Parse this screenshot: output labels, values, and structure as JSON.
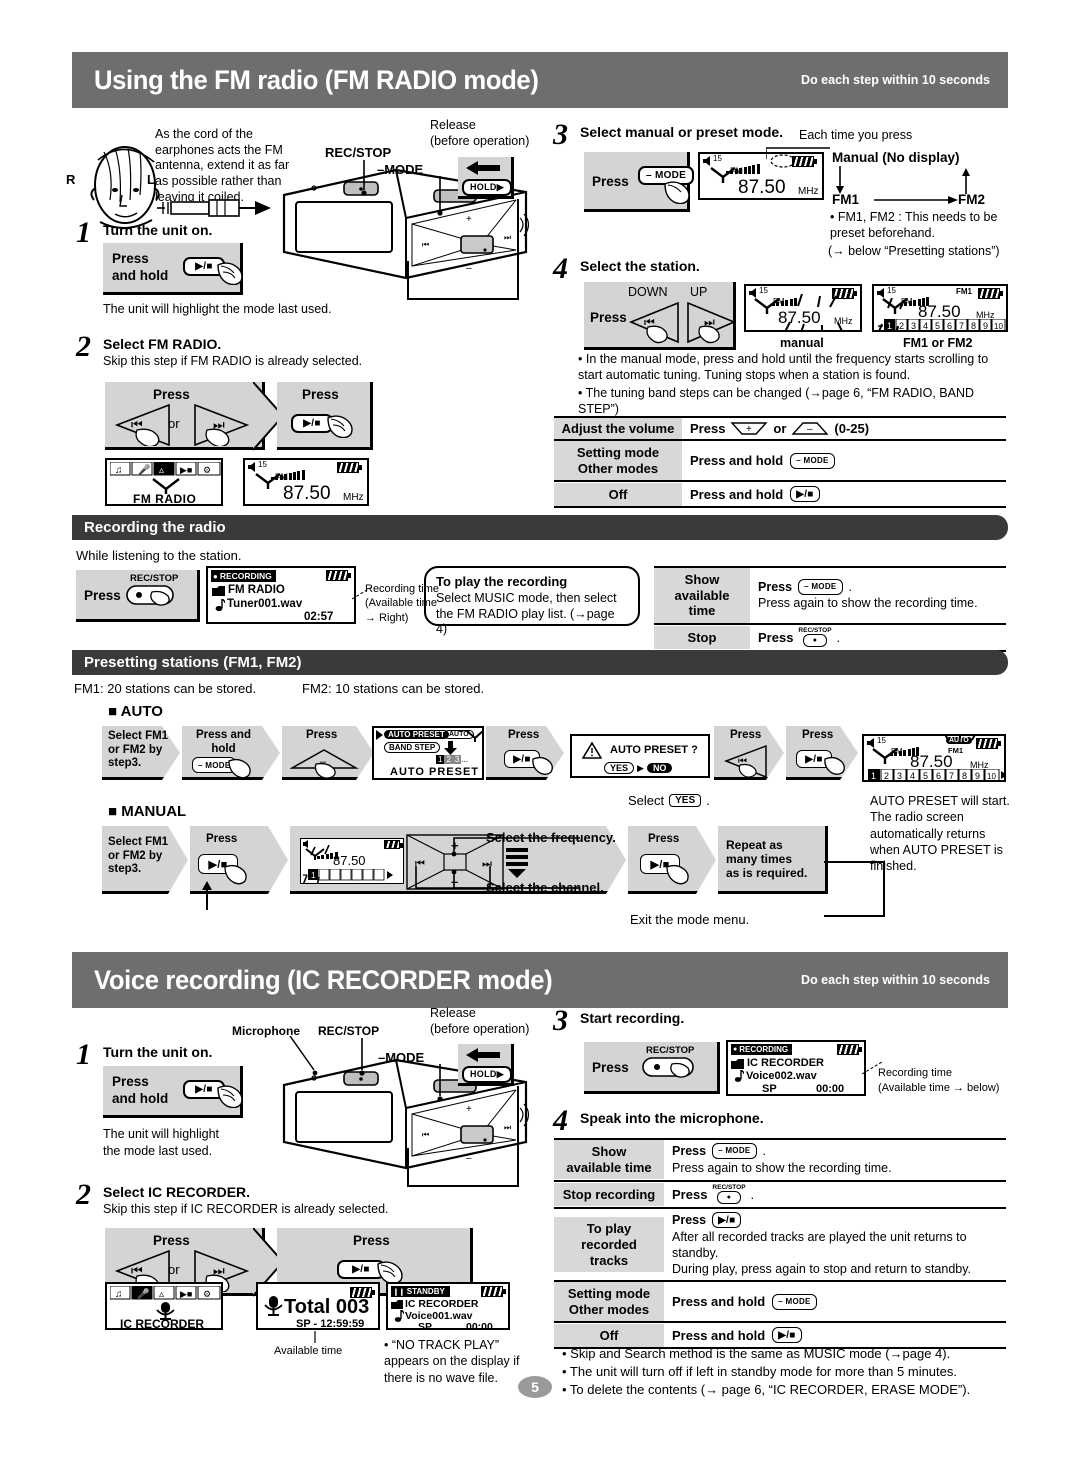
{
  "page_number": "5",
  "fm_section": {
    "title": "Using the FM radio (FM RADIO mode)",
    "note": "Do each step within 10 seconds",
    "antenna_note": "As the cord of the earphones acts the FM antenna, extend it as far as possible rather than leaving it coiled.",
    "ear_r": "R",
    "ear_l": "L",
    "label_rec_stop": "REC/STOP",
    "label_mode": "–MODE",
    "label_release": "Release\n(before operation)",
    "label_hold": "HOLD▶",
    "step1": {
      "num": "1",
      "title": "Turn the unit on.",
      "press_label": "Press\nand hold",
      "key": "▶/■",
      "after": "The unit will highlight the mode last used."
    },
    "step2": {
      "num": "2",
      "title": "Select FM RADIO.",
      "sub": "Skip this step if FM RADIO is already selected.",
      "press1": "Press",
      "or": "or",
      "press2": "Press",
      "key_prev": "⏮",
      "key_next": "⏭",
      "key_play": "▶/■",
      "menu_label": "FM RADIO",
      "lcd_vol": "15",
      "lcd_band": "FM",
      "lcd_freq": "87.50",
      "lcd_unit": "MHz"
    },
    "step3": {
      "num": "3",
      "title": "Select manual or preset mode.",
      "press": "Press",
      "key_mode": "– MODE",
      "lcd_vol": "15",
      "lcd_band": "FM",
      "lcd_freq": "87.50",
      "lcd_unit": "MHz",
      "each_time": "Each time you press",
      "cycle_manual": "Manual (No display)",
      "cycle_fm1": "FM1",
      "cycle_fm2": "FM2",
      "bullet": "• FM1, FM2 : This needs to be preset beforehand.",
      "bullet2": "(→ below “Presetting stations”)"
    },
    "step4": {
      "num": "4",
      "title": "Select the station.",
      "press": "Press",
      "down": "DOWN",
      "up": "UP",
      "key_prev": "⏮",
      "key_next": "⏭",
      "lcd1_caption": "manual",
      "lcd2_caption": "FM1 or FM2",
      "lcd_vol": "15",
      "lcd_band": "FM",
      "lcd_freq": "87.50",
      "lcd_unit": "MHz",
      "lcd2_fm1": "FM1",
      "presets": [
        "1",
        "2",
        "3",
        "4",
        "5",
        "6",
        "7",
        "8",
        "9",
        "10"
      ],
      "bullet1": "• In the manual mode, press and hold until the frequency starts scrolling to start automatic tuning. Tuning stops when a station is found.",
      "bullet2": "• The tuning band steps can be changed (→page 6, “FM RADIO, BAND STEP”)"
    },
    "ops_table": [
      {
        "key": "Adjust the volume",
        "value_pre": "Press",
        "value_post": "(0-25)",
        "kind": "volume"
      },
      {
        "key": "Setting mode\nOther modes",
        "value_pre": "Press and hold",
        "key_glyph": "– MODE",
        "kind": "mode"
      },
      {
        "key": "Off",
        "value_pre": "Press and hold",
        "key_glyph": "▶/■",
        "kind": "play"
      }
    ]
  },
  "recording_section": {
    "title": "Recording the radio",
    "intro": "While listening to the station.",
    "press": "Press",
    "key_rec": "REC/STOP",
    "lcd_status": "RECORDING",
    "lcd_line1": "FM  RADIO",
    "lcd_line2": "Tuner001.wav",
    "lcd_time": "02:57",
    "callout": "Recording time\n(Available time\n→ Right)",
    "note_title": "To play the recording",
    "note_body": "Select MUSIC mode, then select the FM RADIO play list. (→page 4)",
    "ops_table": [
      {
        "key": "Show available\ntime",
        "value_pre": "Press",
        "key_glyph": "– MODE",
        "value_post": ".",
        "extra": "Press again to show the recording time."
      },
      {
        "key": "Stop",
        "value_pre": "Press",
        "key_glyph": "REC/STOP",
        "value_post": "."
      }
    ]
  },
  "preset_section": {
    "title": "Presetting stations (FM1, FM2)",
    "fm1_note": "FM1: 20 stations can be stored.",
    "fm2_note": "FM2: 10 stations can be stored.",
    "auto_heading": "AUTO",
    "manual_heading": "MANUAL",
    "auto_steps": {
      "s1": "Select FM1\nor FM2 by\nstep3.",
      "s2": "Press and\nhold",
      "s2_key": "– MODE",
      "s3": "Press",
      "s4_lcd_line1": "AUTO PRESET",
      "s4_lcd_auto": "AUTO",
      "s4_lcd_line2": "BAND STEP",
      "s4_lcd_nums": "1 2 3 ...",
      "s4_lcd_caption": "AUTO PRESET",
      "s5": "Press",
      "s5_key": "▶/■",
      "s6_lcd_warn": "AUTO PRESET ?",
      "s6_yes": "YES",
      "s6_no": "NO",
      "s7": "Press",
      "s7_key": "⏮",
      "s7_caption": "Select",
      "s7_caption_key": "YES",
      "s7_caption_end": ".",
      "s8": "Press",
      "s8_key": "▶/■",
      "s9_lcd_vol": "15",
      "s9_lcd_auto": "AUTO",
      "s9_lcd_fm1": "FM1",
      "s9_lcd_band": "FM",
      "s9_lcd_freq": "87.50",
      "s9_lcd_unit": "MHz",
      "s9_presets": [
        "1",
        "2",
        "3",
        "4",
        "5",
        "6",
        "7",
        "8",
        "9",
        "10"
      ],
      "after_note": "AUTO PRESET will start. The radio screen automatically returns when AUTO PRESET is finished."
    },
    "manual_steps": {
      "m1": "Select FM1\nor FM2 by\nstep3.",
      "m2": "Press",
      "m2_key": "▶/■",
      "m3_freq_label": "Select the frequency.",
      "m3_chan_label": "Select the channel.",
      "m3_lcd_freq": "87.50",
      "m3_plus": "+",
      "m3_minus": "–",
      "m4": "Press",
      "m4_key": "▶/■",
      "m5": "Repeat as\nmany times\nas is required.",
      "exit_note": "Exit the mode menu."
    }
  },
  "voice_section": {
    "title": "Voice recording (IC RECORDER mode)",
    "note": "Do each step within 10 seconds",
    "label_microphone": "Microphone",
    "label_rec_stop": "REC/STOP",
    "label_mode": "–MODE",
    "label_release": "Release\n(before operation)",
    "label_hold": "HOLD▶",
    "step1": {
      "num": "1",
      "title": "Turn the unit on.",
      "press_label": "Press\nand hold",
      "key": "▶/■",
      "after": "The unit will highlight\nthe mode last used."
    },
    "step2": {
      "num": "2",
      "title": "Select IC RECORDER.",
      "sub": "Skip this step if IC RECORDER is already selected.",
      "press1": "Press",
      "or": "or",
      "press2": "Press",
      "key_prev": "⏮",
      "key_next": "⏭",
      "key_play": "▶/■",
      "menu_label": "IC RECORDER",
      "lcd_total": "Total 003",
      "lcd_sp": "SP  - 12:59:59",
      "lcd_avail_caption": "Available time",
      "lcd3_status": "STANDBY",
      "lcd3_line1": "IC  RECORDER",
      "lcd3_line2": "Voice001.wav",
      "lcd3_sp": "SP",
      "lcd3_time": "00:00",
      "no_track_note": "• “NO TRACK PLAY” appears on the display if there is no wave file."
    },
    "step3": {
      "num": "3",
      "title": "Start recording.",
      "press": "Press",
      "key_rec": "REC/STOP",
      "lcd_status": "RECORDING",
      "lcd_line1": "IC  RECORDER",
      "lcd_line2": "Voice002.wav",
      "lcd_sp": "SP",
      "lcd_time": "00:00",
      "callout": "Recording time\n(Available time → below)"
    },
    "step4": {
      "num": "4",
      "title": "Speak into the microphone."
    },
    "ops_table": [
      {
        "key": "Show\navailable time",
        "value_pre": "Press",
        "key_glyph": "– MODE",
        "value_post": ".",
        "extra": "Press again to show the recording time."
      },
      {
        "key": "Stop recording",
        "value_pre": "Press",
        "key_glyph": "REC/STOP",
        "value_post": "."
      },
      {
        "key": "To play\nrecorded\ntracks",
        "value_pre": "Press",
        "key_glyph": "▶/■",
        "extra": "After all recorded tracks are played the unit returns to standby.\nDuring play, press again to stop and return to standby."
      },
      {
        "key": "Setting mode\nOther modes",
        "value_pre": "Press and hold",
        "key_glyph": "– MODE"
      },
      {
        "key": "Off",
        "value_pre": "Press and hold",
        "key_glyph": "▶/■"
      }
    ],
    "bullets": [
      "• Skip and Search method is the same as MUSIC mode (→page 4).",
      "• The unit will turn off if left in standby mode for more than 5 minutes.",
      "• To delete the contents (→ page 6, “IC RECORDER, ERASE MODE”)."
    ]
  }
}
